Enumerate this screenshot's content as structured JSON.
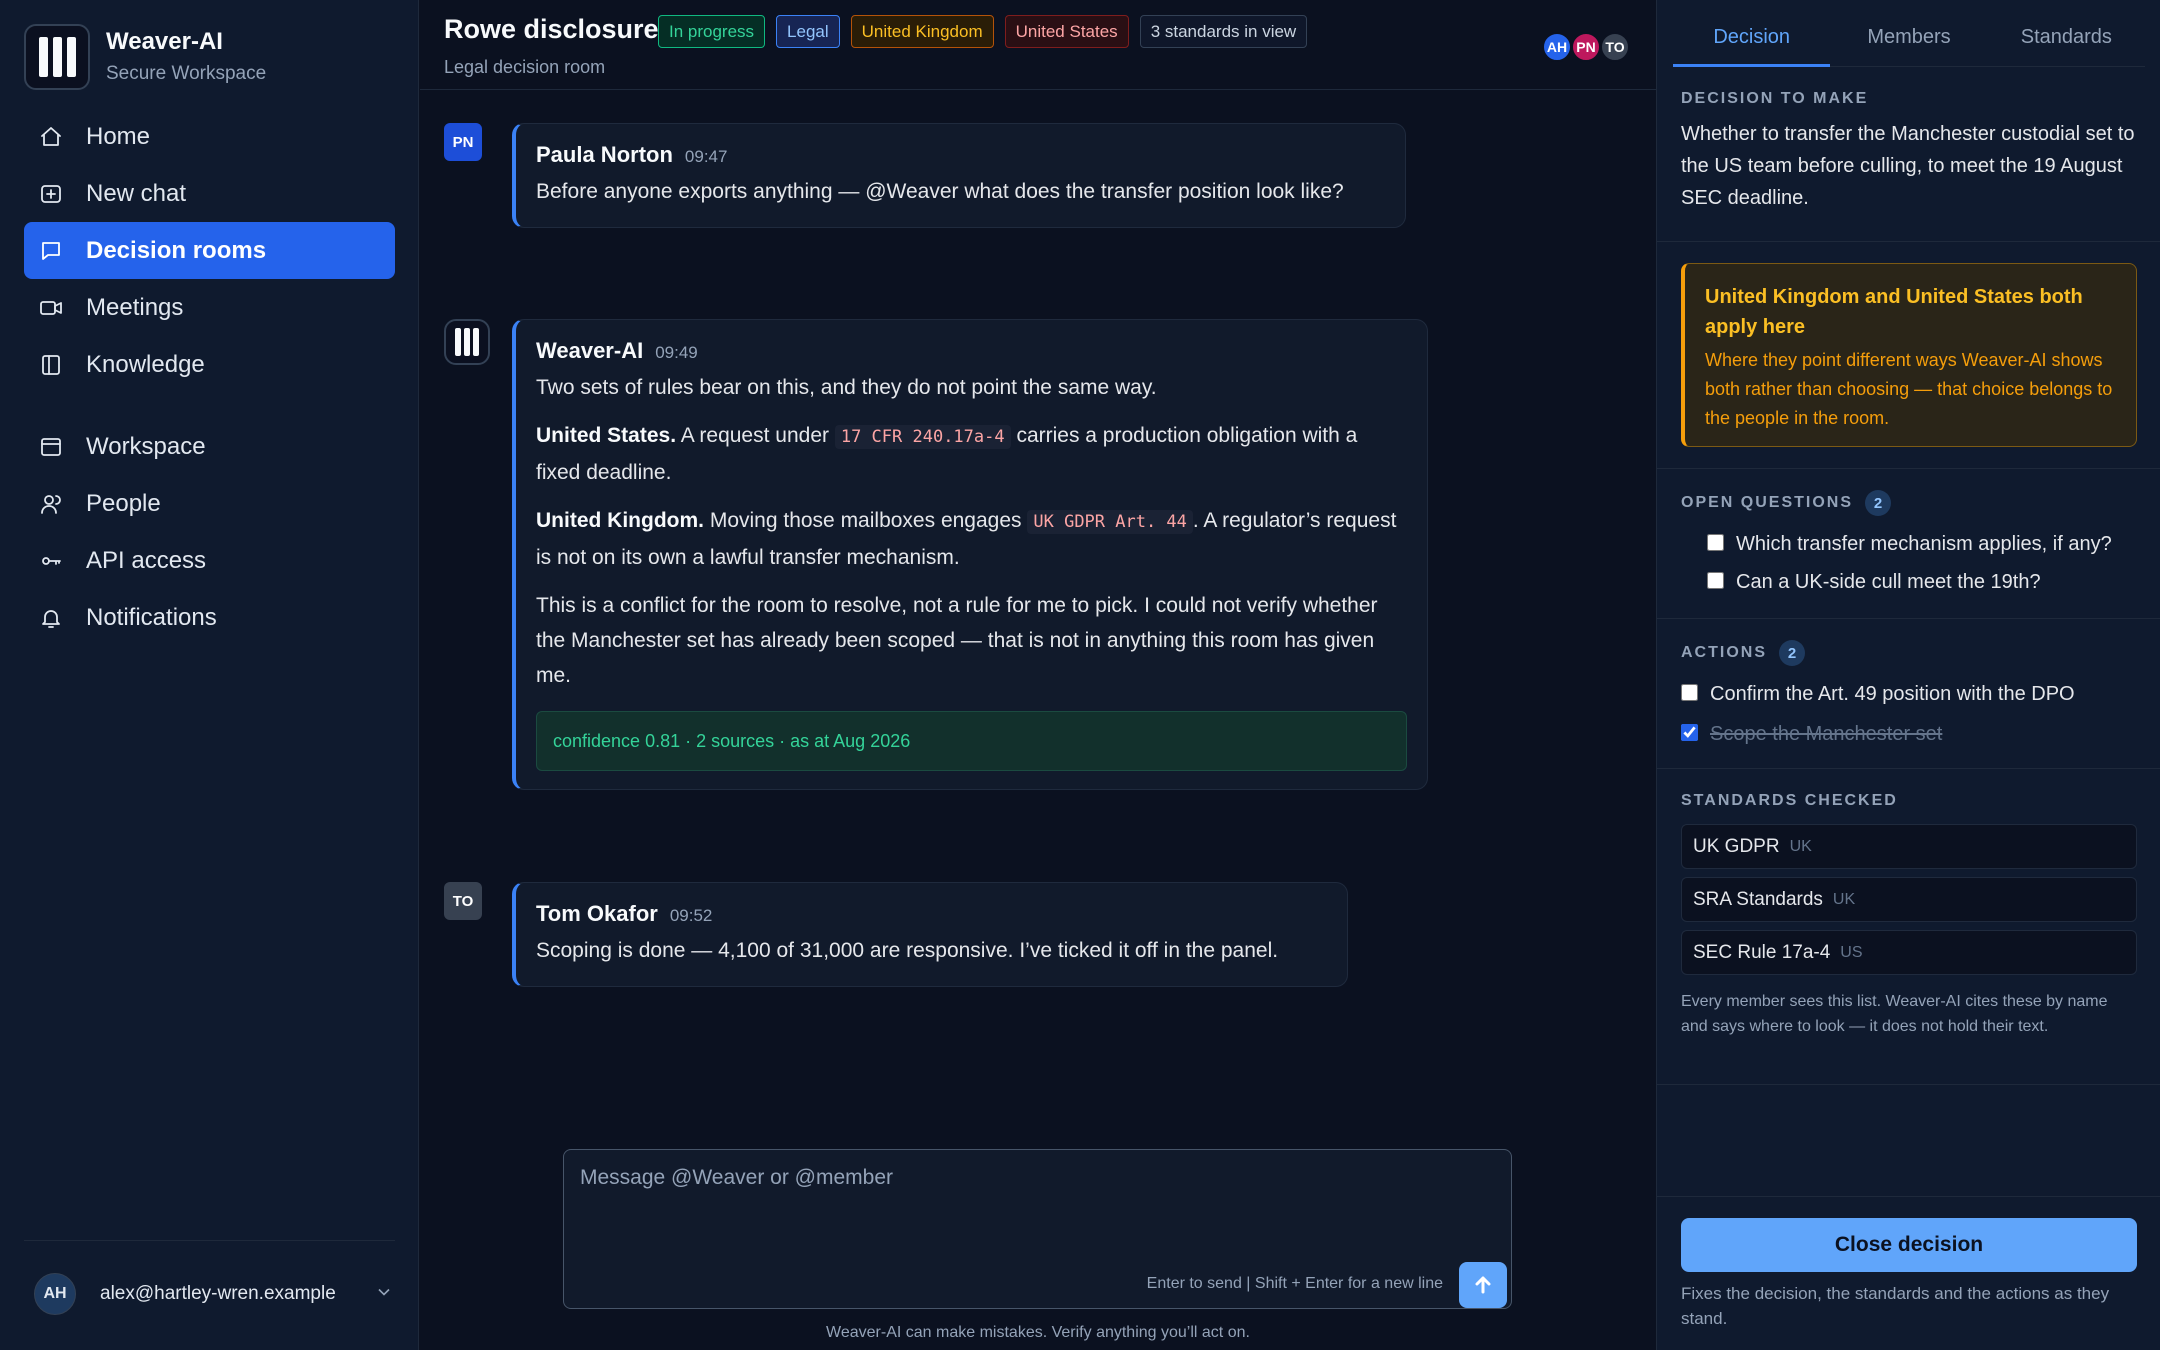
{
  "app": {
    "name": "Weaver-AI",
    "subtitle": "Secure Workspace"
  },
  "nav": [
    {
      "label": "Home",
      "icon": "home-icon"
    },
    {
      "label": "New chat",
      "icon": "plus-square-icon"
    },
    {
      "label": "Decision rooms",
      "icon": "chat-bubble-icon",
      "active": true
    },
    {
      "label": "Meetings",
      "icon": "video-icon"
    },
    {
      "label": "Knowledge",
      "icon": "book-icon"
    },
    {
      "label": "Workspace",
      "icon": "window-icon"
    },
    {
      "label": "People",
      "icon": "person-icon"
    },
    {
      "label": "API access",
      "icon": "key-icon"
    },
    {
      "label": "Notifications",
      "icon": "bell-icon"
    }
  ],
  "account": {
    "initials": "AH",
    "email": "alex@hartley-wren.example"
  },
  "header": {
    "title": "Rowe disclosure",
    "subtitle": "Legal decision room",
    "tags": [
      "In progress",
      "Legal",
      "United Kingdom",
      "United States",
      "3 standards in view"
    ],
    "members": [
      "AH",
      "PN",
      "TO"
    ],
    "member_colors": [
      "#2563eb",
      "#be185d",
      "#374151"
    ]
  },
  "messages": [
    {
      "initials": "PN",
      "author": "Paula Norton",
      "time": "09:47",
      "text": "Before anyone exports anything — @Weaver what does the transfer position look like?"
    },
    {
      "author": "Weaver-AI",
      "time": "09:49",
      "intro": "Two sets of rules bear on this, and they do not point the same way.",
      "us_lead": "United States.",
      "us_before": "A request under",
      "us_code": "17 CFR 240.17a-4",
      "us_after": "carries a production obligation with a fixed deadline.",
      "uk_lead": "United Kingdom.",
      "uk_before": "Moving those mailboxes engages",
      "uk_code": "UK GDPR Art. 44",
      "uk_after": ". A regulator’s request is not on its own a lawful transfer mechanism.",
      "closing": "This is a conflict for the room to resolve, not a rule for me to pick. I could not verify whether the Manchester set has already been scoped — that is not in anything this room has given me.",
      "confidence": "confidence 0.81 · 2 sources · as at Aug 2026"
    },
    {
      "initials": "TO",
      "author": "Tom Okafor",
      "time": "09:52",
      "text": "Scoping is done — 4,100 of 31,000 are responsive. I’ve ticked it off in the panel."
    }
  ],
  "composer": {
    "placeholder": "Message @Weaver or @member",
    "hint": "Enter to send | Shift + Enter for a new line",
    "disclaimer": "Weaver-AI can make mistakes. Verify anything you’ll act on."
  },
  "panel": {
    "tabs": [
      "Decision",
      "Members",
      "Standards"
    ],
    "decision_label": "Decision to make",
    "decision_text": "Whether to transfer the Manchester custodial set to the US team before culling, to meet the 19 August SEC deadline.",
    "conflict_title": "United Kingdom and United States both apply here",
    "conflict_body": "Where they point different ways Weaver-AI shows both rather than choosing — that choice belongs to the people in the room.",
    "questions_label": "Open questions",
    "questions_count": "2",
    "questions": [
      {
        "text": "Which transfer mechanism applies, if any?",
        "checked": false
      },
      {
        "text": "Can a UK-side cull meet the 19th?",
        "checked": false
      }
    ],
    "actions_label": "Actions",
    "actions_count": "2",
    "actions": [
      {
        "text": "Confirm the Art. 49 position with the DPO",
        "checked": false
      },
      {
        "text": "Scope the Manchester set",
        "checked": true
      }
    ],
    "standards_label": "Standards checked",
    "standards": [
      {
        "name": "UK GDPR",
        "region": "UK"
      },
      {
        "name": "SRA Standards",
        "region": "UK"
      },
      {
        "name": "SEC Rule 17a-4",
        "region": "US"
      }
    ],
    "standards_note": "Every member sees this list. Weaver-AI cites these by name and says where to look — it does not hold their text.",
    "close_label": "Close decision",
    "close_note": "Fixes the decision, the standards and the actions as they stand."
  },
  "colors": {
    "accent": "#2563eb",
    "accent_light": "#60a5fa",
    "warning": "#f59e0b",
    "success": "#34d399"
  }
}
